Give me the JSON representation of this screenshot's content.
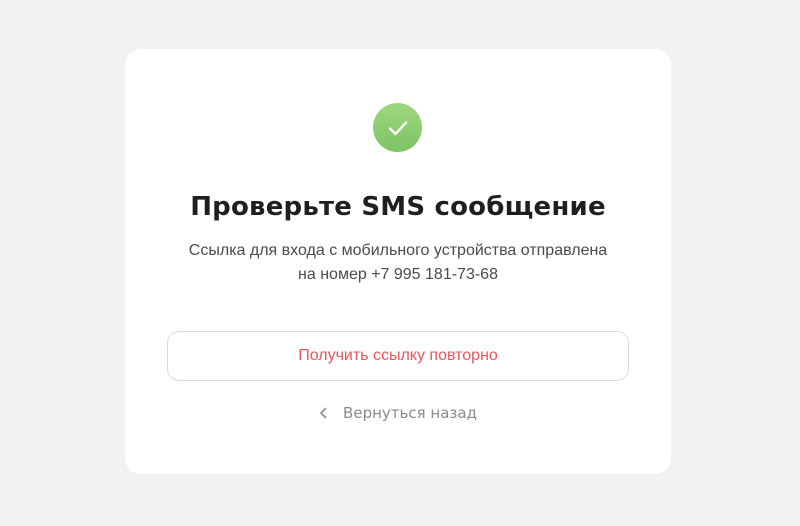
{
  "status": {
    "icon": "check-icon",
    "accent_color": "#8fce73"
  },
  "heading": {
    "title": "Проверьте SMS сообщение"
  },
  "message": {
    "line1": "Ссылка для входа с мобильного устройства отправлена",
    "line2": "на номер +7 995 181-73-68"
  },
  "actions": {
    "resend_label": "Получить ссылку повторно",
    "resend_color": "#e8565a",
    "back_label": "Вернуться назад",
    "back_icon": "chevron-left-icon"
  }
}
